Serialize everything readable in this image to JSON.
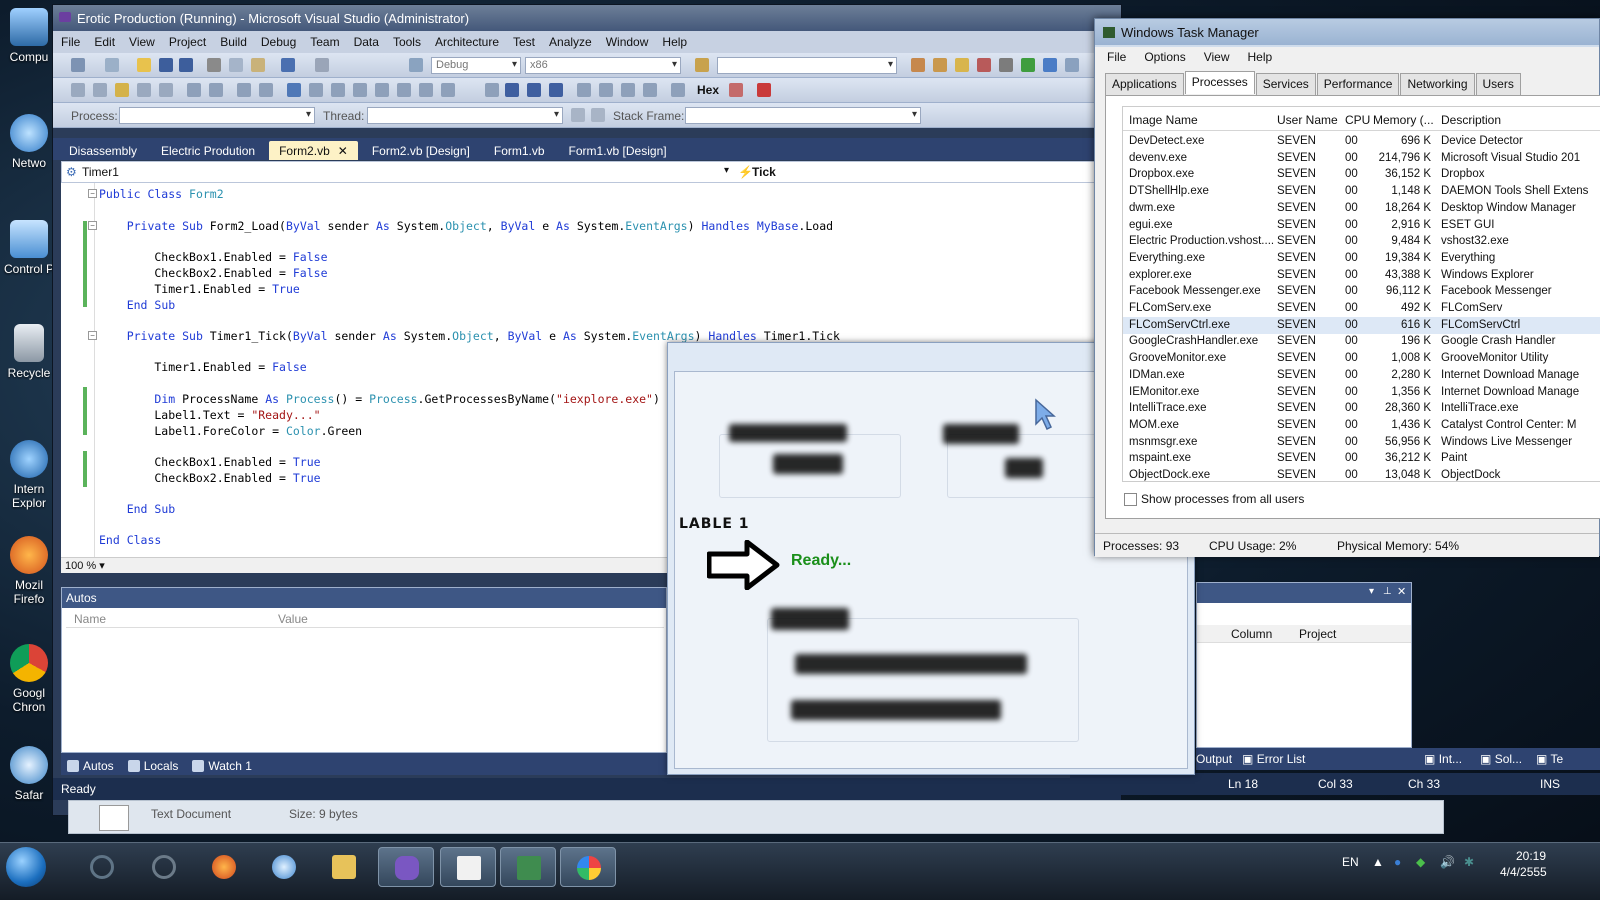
{
  "desktop": {
    "icons": [
      {
        "label": "Compu",
        "icon": "computer-icon"
      },
      {
        "label": "Netwo",
        "icon": "network-icon"
      },
      {
        "label": "Control P",
        "icon": "control-panel-icon"
      },
      {
        "label": "Recycle",
        "icon": "recycle-bin-icon"
      },
      {
        "label": "Intern Explor",
        "icon": "internet-explorer-icon"
      },
      {
        "label": "Mozil Firefo",
        "icon": "firefox-icon"
      },
      {
        "label": "Googl Chron",
        "icon": "chrome-icon"
      },
      {
        "label": "Safar",
        "icon": "safari-icon"
      }
    ]
  },
  "vs": {
    "title": "Erotic Production (Running) - Microsoft Visual Studio (Administrator)",
    "menu": [
      "File",
      "Edit",
      "View",
      "Project",
      "Build",
      "Debug",
      "Team",
      "Data",
      "Tools",
      "Architecture",
      "Test",
      "Analyze",
      "Window",
      "Help"
    ],
    "toolbar": {
      "config": "Debug",
      "platform": "x86",
      "hex_label": "Hex",
      "process_label": "Process:",
      "thread_label": "Thread:",
      "stack_label": "Stack Frame:"
    },
    "tabs": [
      {
        "label": "Disassembly"
      },
      {
        "label": "Electric Prodution"
      },
      {
        "label": "Form2.vb",
        "active": true
      },
      {
        "label": "Form2.vb [Design]"
      },
      {
        "label": "Form1.vb"
      },
      {
        "label": "Form1.vb [Design]"
      }
    ],
    "nav": {
      "left": "Timer1",
      "right": "Tick"
    },
    "code": [
      "Public Class Form2",
      "    Private Sub Form2_Load(ByVal sender As System.Object, ByVal e As System.EventArgs) Handles MyBase.Load",
      "        CheckBox1.Enabled = False",
      "        CheckBox2.Enabled = False",
      "        Timer1.Enabled = True",
      "    End Sub",
      "    Private Sub Timer1_Tick(ByVal sender As System.Object, ByVal e As System.EventArgs) Handles Timer1.Tick",
      "        Timer1.Enabled = False",
      "        Dim ProcessName As Process() = Process.GetProcessesByName(\"iexplore.exe\")",
      "        Label1.Text = \"Ready...\"",
      "        Label1.ForeColor = Color.Green",
      "        CheckBox1.Enabled = True",
      "        CheckBox2.Enabled = True",
      "    End Sub",
      "End Class"
    ],
    "zoom": "100 %",
    "autos": {
      "title": "Autos",
      "col_name": "Name",
      "col_value": "Value"
    },
    "bottom_tabs": [
      "Autos",
      "Locals",
      "Watch 1"
    ],
    "errlist": {
      "col_column": "Column",
      "col_project": "Project"
    },
    "right_tabs": [
      "Output",
      "Error List",
      "Int...",
      "Sol...",
      "Te"
    ],
    "status": {
      "ready": "Ready",
      "ln": "Ln 18",
      "col": "Col 33",
      "ch": "Ch 33",
      "ins": "INS"
    }
  },
  "form": {
    "lable": "LABLE 1",
    "ready": "Ready...",
    "ready_color": "#1a8f1a"
  },
  "taskmgr": {
    "title": "Windows Task Manager",
    "menu": [
      "File",
      "Options",
      "View",
      "Help"
    ],
    "tabs": [
      "Applications",
      "Processes",
      "Services",
      "Performance",
      "Networking",
      "Users"
    ],
    "active_tab": "Processes",
    "columns": [
      "Image Name",
      "User Name",
      "CPU",
      "Memory (...",
      "Description"
    ],
    "rows": [
      [
        "DevDetect.exe",
        "SEVEN",
        "00",
        "696 K",
        "Device Detector"
      ],
      [
        "devenv.exe",
        "SEVEN",
        "00",
        "214,796 K",
        "Microsoft Visual Studio 201"
      ],
      [
        "Dropbox.exe",
        "SEVEN",
        "00",
        "36,152 K",
        "Dropbox"
      ],
      [
        "DTShellHlp.exe",
        "SEVEN",
        "00",
        "1,148 K",
        "DAEMON Tools Shell Extens"
      ],
      [
        "dwm.exe",
        "SEVEN",
        "00",
        "18,264 K",
        "Desktop Window Manager"
      ],
      [
        "egui.exe",
        "SEVEN",
        "00",
        "2,916 K",
        "ESET GUI"
      ],
      [
        "Electric Production.vshost....",
        "SEVEN",
        "00",
        "9,484 K",
        "vshost32.exe"
      ],
      [
        "Everything.exe",
        "SEVEN",
        "00",
        "19,384 K",
        "Everything"
      ],
      [
        "explorer.exe",
        "SEVEN",
        "00",
        "43,388 K",
        "Windows Explorer"
      ],
      [
        "Facebook Messenger.exe",
        "SEVEN",
        "00",
        "96,112 K",
        "Facebook Messenger"
      ],
      [
        "FLComServ.exe",
        "SEVEN",
        "00",
        "492 K",
        "FLComServ"
      ],
      [
        "FLComServCtrl.exe",
        "SEVEN",
        "00",
        "616 K",
        "FLComServCtrl"
      ],
      [
        "GoogleCrashHandler.exe",
        "SEVEN",
        "00",
        "196 K",
        "Google Crash Handler"
      ],
      [
        "GrooveMonitor.exe",
        "SEVEN",
        "00",
        "1,008 K",
        "GrooveMonitor Utility"
      ],
      [
        "IDMan.exe",
        "SEVEN",
        "00",
        "2,280 K",
        "Internet Download Manage"
      ],
      [
        "IEMonitor.exe",
        "SEVEN",
        "00",
        "1,356 K",
        "Internet Download Manage"
      ],
      [
        "IntelliTrace.exe",
        "SEVEN",
        "00",
        "28,360 K",
        "IntelliTrace.exe"
      ],
      [
        "MOM.exe",
        "SEVEN",
        "00",
        "1,436 K",
        "Catalyst Control Center: M"
      ],
      [
        "msnmsgr.exe",
        "SEVEN",
        "00",
        "56,956 K",
        "Windows Live Messenger"
      ],
      [
        "mspaint.exe",
        "SEVEN",
        "00",
        "36,212 K",
        "Paint"
      ],
      [
        "ObjectDock.exe",
        "SEVEN",
        "00",
        "13,048 K",
        "ObjectDock"
      ]
    ],
    "selected_row": 11,
    "show_all": "Show processes from all users",
    "status": {
      "processes": "Processes: 93",
      "cpu": "CPU Usage: 2%",
      "memory": "Physical Memory: 54%"
    }
  },
  "fileinfo": {
    "type": "Text Document",
    "size": "Size: 9 bytes"
  },
  "taskbar": {
    "items": [
      "ie-icon",
      "ccleaner-icon",
      "firefox-icon",
      "safari-icon",
      "folder-icon",
      "visual-studio-icon",
      "notepad-icon",
      "task-manager-icon",
      "paint-icon"
    ],
    "lang": "EN",
    "time": "20:19",
    "date": "4/4/2555"
  }
}
